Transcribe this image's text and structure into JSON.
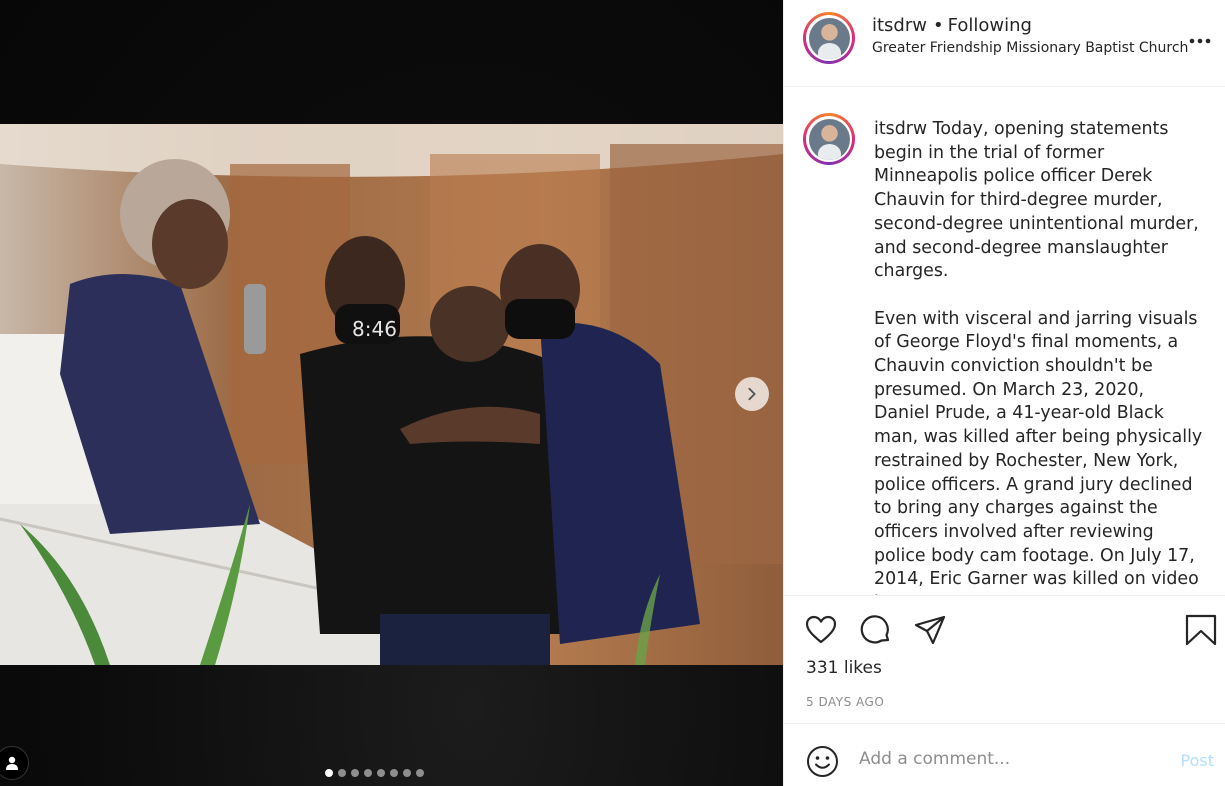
{
  "post": {
    "media": {
      "carousel_total": 8,
      "carousel_active": 0,
      "next_icon": "chevron-right-icon",
      "tag_icon": "user-tag-icon",
      "photo_text": {
        "mask": "8:46"
      }
    },
    "header": {
      "username": "itsdrw",
      "bullet": "•",
      "follow_status": "Following",
      "location": "Greater Friendship Missionary Baptist Church",
      "more_icon": "more-options-icon",
      "more_label": "•••"
    },
    "caption": {
      "username": "itsdrw",
      "paragraph1": "Today, opening statements begin in the trial of former Minneapolis police officer Derek Chauvin for third-degree murder, second-degree unintentional murder, and second-degree manslaughter charges.",
      "paragraph2": "Even with visceral and jarring visuals of George Floyd's final moments, a Chauvin conviction shouldn't be presumed. On March 23, 2020, Daniel Prude, a 41-year-old Black man, was killed after being physically restrained by Rochester, New York, police officers. A grand jury declined to bring any charges against the officers involved after reviewing police body cam footage. On July 17, 2014, Eric Garner was killed on video by a New"
    },
    "actions": {
      "like_icon": "heart-icon",
      "comment_icon": "comment-icon",
      "share_icon": "share-icon",
      "save_icon": "bookmark-icon"
    },
    "likes": "331 likes",
    "date": "5 DAYS AGO",
    "comment_box": {
      "emoji_icon": "emoji-icon",
      "placeholder": "Add a comment...",
      "post_label": "Post"
    }
  },
  "colors": {
    "post_button_disabled": "#b2dffc",
    "secondary_text": "#8e8e8e",
    "border": "#efefef"
  }
}
